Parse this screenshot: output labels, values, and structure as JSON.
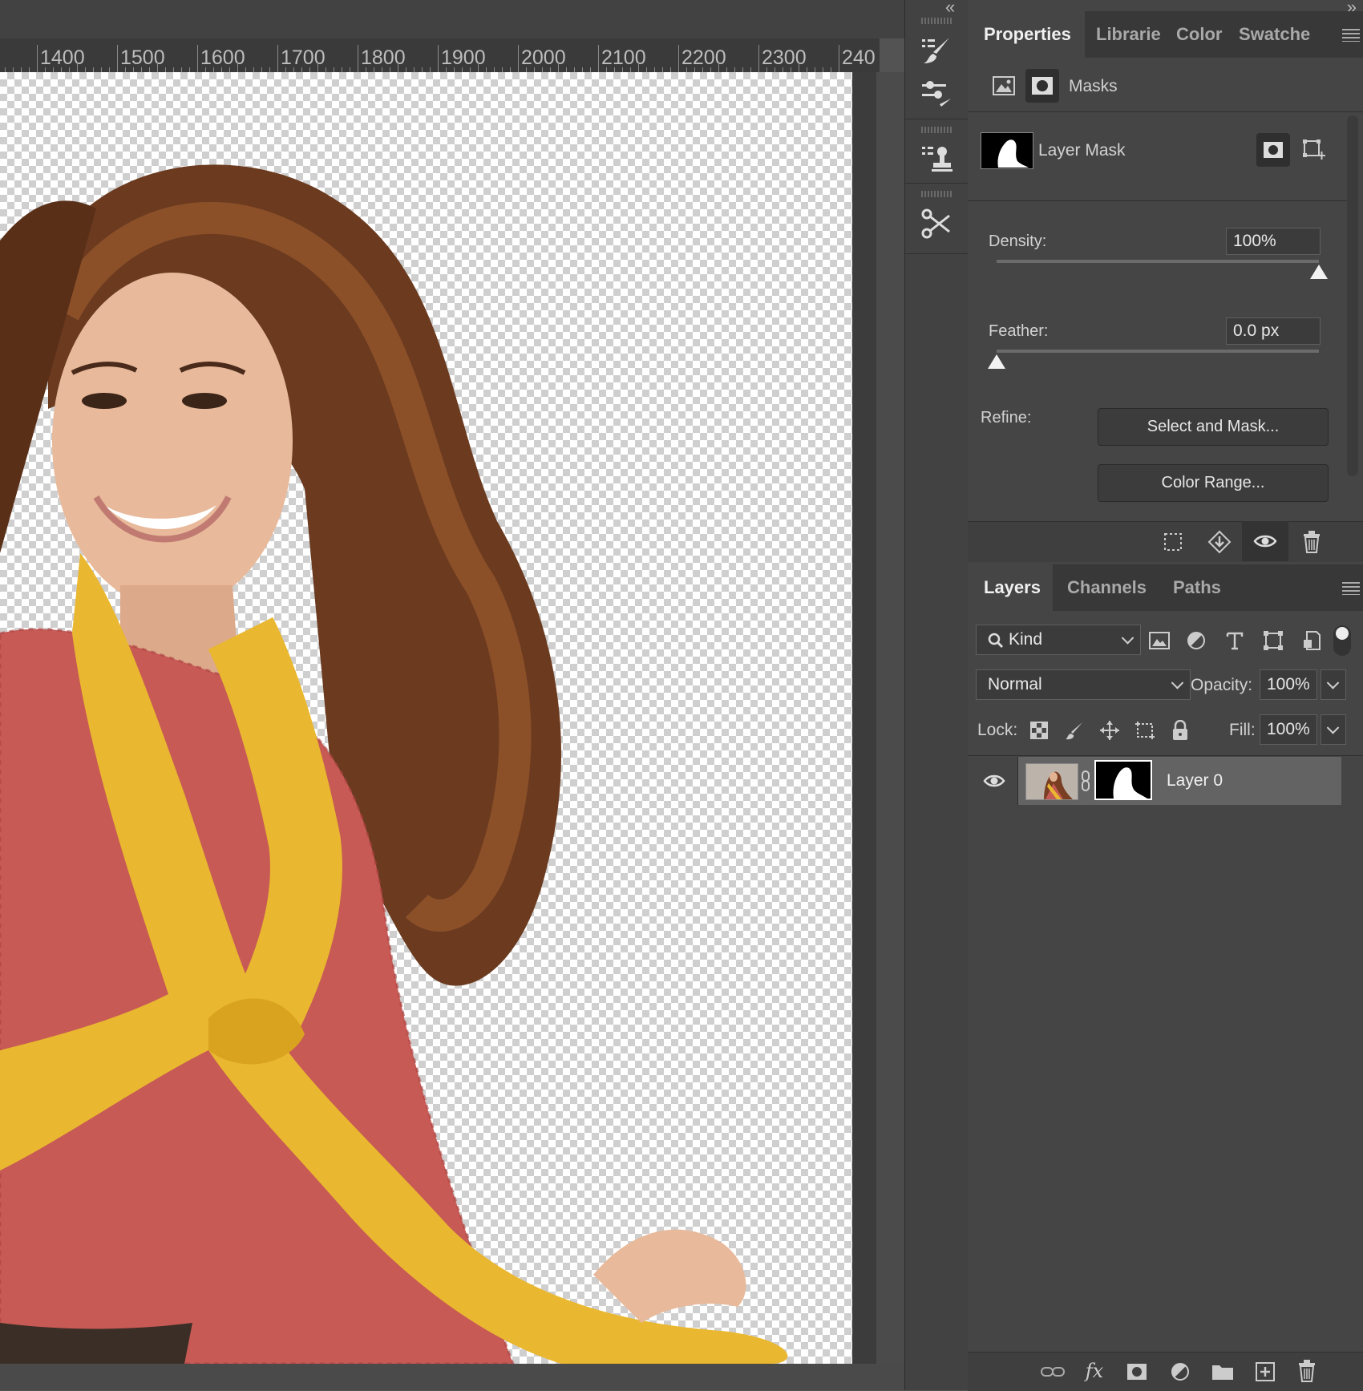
{
  "ruler": {
    "labels": [
      "1400",
      "1500",
      "1600",
      "1700",
      "1800",
      "1900",
      "2000",
      "2100",
      "2200",
      "2300",
      "240"
    ]
  },
  "canvas": {
    "image_description_icon": "woman-cutout-image"
  },
  "properties_panel": {
    "tabs": [
      {
        "label": "Properties",
        "active": true
      },
      {
        "label": "Librarie",
        "active": false
      },
      {
        "label": "Color",
        "active": false
      },
      {
        "label": "Swatche",
        "active": false
      }
    ],
    "section_label": "Masks",
    "layer_mask_label": "Layer Mask",
    "density_label": "Density:",
    "density_value": "100%",
    "density_level_percent": 100,
    "feather_label": "Feather:",
    "feather_value": "0.0 px",
    "feather_level_percent": 0,
    "refine_label": "Refine:",
    "select_and_mask_label": "Select and Mask...",
    "color_range_label": "Color Range..."
  },
  "layers_panel": {
    "tabs": [
      {
        "label": "Layers",
        "active": true
      },
      {
        "label": "Channels",
        "active": false
      },
      {
        "label": "Paths",
        "active": false
      }
    ],
    "filter_kind": "Kind",
    "blend_mode": "Normal",
    "opacity_label": "Opacity:",
    "opacity_value": "100%",
    "lock_label": "Lock:",
    "fill_label": "Fill:",
    "fill_value": "100%",
    "layers": [
      {
        "name": "Layer 0",
        "visible": true,
        "selected": true
      }
    ]
  },
  "colors": {
    "panel_bg": "#454545",
    "tabbar_bg": "#383838",
    "selected_layer_bg": "#636363"
  }
}
